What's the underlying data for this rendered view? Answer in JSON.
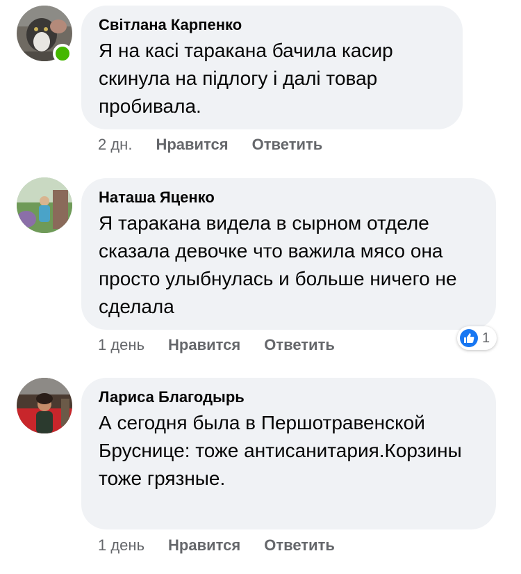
{
  "comments": [
    {
      "author": "Світлана Карпенко",
      "text": "Я на касі  таракана бачила касир скинула  на підлогу і далі товар пробивала.",
      "time": "2 дн.",
      "like_label": "Нравится",
      "reply_label": "Ответить",
      "online": true
    },
    {
      "author": "Наташа Яценко",
      "text": "Я таракана видела в сырном отделе сказала девочке что важила мясо она просто улыбнулась и больше ничего не сделала",
      "time": "1 день",
      "like_label": "Нравится",
      "reply_label": "Ответить",
      "reaction_count": "1"
    },
    {
      "author": "Лариса Благодырь",
      "text": "А сегодня была в Першотравенской Бруснице: тоже антисанитария.Корзины тоже грязные.",
      "time": "1 день",
      "like_label": "Нравится",
      "reply_label": "Ответить"
    }
  ],
  "colors": {
    "bubble": "#f0f2f5",
    "meta": "#65676b",
    "like": "#1877f2",
    "online": "#44b700"
  }
}
